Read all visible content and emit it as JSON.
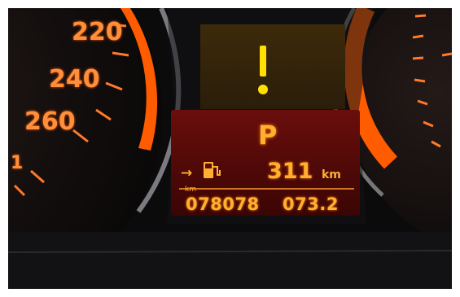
{
  "speedometer": {
    "labels": [
      "220",
      "240",
      "260",
      "1"
    ]
  },
  "warning": {
    "symbol": "!"
  },
  "display": {
    "gear": "P",
    "range_arrow": "→",
    "range_value": "311",
    "range_unit": "km",
    "odometer_unit": "km",
    "odometer": "078078",
    "trip": "073.2"
  },
  "colors": {
    "display_text": "#ffb030",
    "needle_ring": "#ff6a00",
    "warning": "#ffe000"
  }
}
